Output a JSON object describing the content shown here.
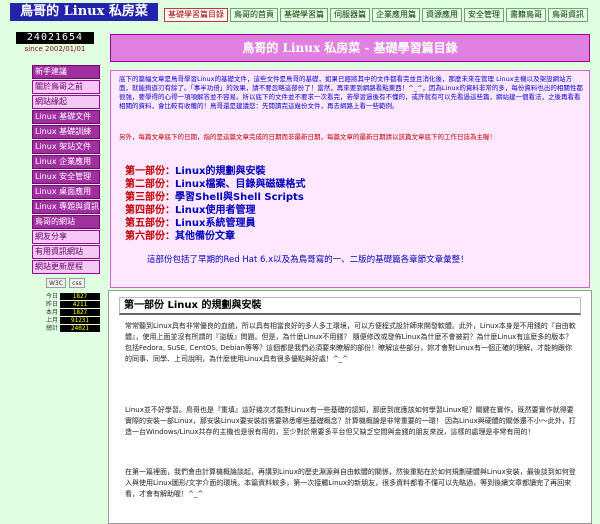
{
  "site": {
    "title": "鳥哥的 Linux 私房菜"
  },
  "nav": [
    {
      "label": "基礎學習篇目錄",
      "active": true
    },
    {
      "label": "鳥哥的首頁"
    },
    {
      "label": "基礎學習篇"
    },
    {
      "label": "伺服器篇"
    },
    {
      "label": "企業應用篇"
    },
    {
      "label": "資源應用"
    },
    {
      "label": "安全管理"
    },
    {
      "label": "書籍鳥哥"
    },
    {
      "label": "鳥哥資訊"
    }
  ],
  "counter": {
    "value": "24021654",
    "since": "since 2002/01/01"
  },
  "sidebar": [
    {
      "label": "新手建議",
      "dark": true
    },
    {
      "label": "關於鳥哥之前"
    },
    {
      "label": "網站緣起"
    },
    {
      "label": "Linux 基礎文件",
      "dark": true
    },
    {
      "label": "Linux 基礎訓練",
      "dark": true
    },
    {
      "label": "Linux 架站文件",
      "dark": true
    },
    {
      "label": "Linux 企業應用",
      "dark": true
    },
    {
      "label": "Linux 安全管理",
      "dark": true
    },
    {
      "label": "Linux 桌面應用",
      "dark": true
    },
    {
      "label": "Linux 專題與資訊",
      "dark": true
    },
    {
      "label": "鳥哥的網站",
      "dark": true
    },
    {
      "label": "網友分享"
    },
    {
      "label": "有用資訊網站"
    },
    {
      "label": "網站更新歷程"
    }
  ],
  "badges": [
    "W3C",
    "css"
  ],
  "clock": [
    {
      "label": "今日",
      "value": "1827"
    },
    {
      "label": "昨日",
      "value": "4211"
    },
    {
      "label": "本月",
      "value": "1827"
    },
    {
      "label": "上月",
      "value": "91231"
    },
    {
      "label": "總計",
      "value": "24021"
    }
  ],
  "banner": {
    "title": "鳥哥的 Linux 私房菜 - 基礎學習篇目錄"
  },
  "intro": {
    "p1": "底下的篇幅文章是鳥哥學習Linux的基礎文件，這些文件是鳥哥的基礎，如果已經將其中的文件都看完並且消化後，那麼未來在管理 Linux主機以及架設網站方面，就能夠遊刃有餘了。「事半功倍」的效果，請不要忽略這部份了！當然，再來要到網路看點東西！^_^，因為Linux的資料非常的多，每份資料也出的相關性都很強，要學得的心得一項項解答並不容易。所以底下的文件並不要求一次看完，若學習過後有不懂的，或許就有可以先看過這些篇，網站建一個看法，之後再看看相關的資料，會比較有收穫的！鳥哥還是建議您：先閱讀完這幾份文件，再去網路上看一些範例。",
    "p2": "另外，每篇文章底下的日期，指的是這篇文章完成的日期而非最新日期，每篇文章的最新日期請以該篇文章底下的工作日誌為主喔！",
    "toc": [
      {
        "label": "第一部份：",
        "text": "Linux的規劃與安裝"
      },
      {
        "label": "第二部份：",
        "text": "Linux檔案、目錄與磁碟格式"
      },
      {
        "label": "第三部份：",
        "text": "學習Shell與Shell Scripts"
      },
      {
        "label": "第四部份：",
        "text": "Linux使用者管理"
      },
      {
        "label": "第五部份：",
        "text": "Linux系統管理員"
      },
      {
        "label": "第六部份：",
        "text": "其他備份文章"
      }
    ],
    "note": "這部份包括了早期的Red Hat 6.x以及為鳥哥寫的一、二版的基礎篇各章節文章彙整！"
  },
  "section": {
    "title": "第一部份 Linux 的規劃與安裝",
    "p1": "常常聽到Linux具有非常優良的血統，所以具有相當良好的多人多工環境，可以方便程式設計師來開發軟體。此外，Linux本身是不用錢的『自由軟體』，使用上面並沒有所謂的『盜版』問題。但是，為什麼Linux不用錢？ 隨便修改或發佈Linux為什麼不會被罰？為什麼Linux有這麼多的版本？包括Fedora, SuSE, CentOS, Debian等等？這個都是我們必須要來瞭解的部份！瞭解這些部分，妳才會對Linux有一個正確的理解，才能夠跟你的同事、同學、上司說明，為什麼使用Linux具有很多優點與好處！^_^",
    "p2": "Linux並不好學習。鳥哥也是『重填』這好幾次才能對Linux有一些基礎的認知，那麼到底應該如何學習Linux呢？關鍵在實作。既然要實作就得要實際的安裝一部Linux，那安裝Linux要安裝前需要熟悉哪些基礎概念？計算機概論是非常重要的一環！ 因為Linux與硬體的關係還不小～此外，打造一台Windows/Linux共存的主機也是很有用的，至少對於需要多平台但又缺乏空間與金錢的朋友來說，這樣的處理是非常有用的！",
    "p3": "在第一篇裡面，我們會由計算機概論談起，再講到Linux的歷史淵源與自由軟體的關係，然後重點在於如何規劃硬體與Linux安裝，最後談到如何登入與使用Linux圖形/文字介面的環境。本篇資料較多，第一次接觸Linux的新朋友，很多資料都看不懂可以先略過，等到後續文章都讀完了再回來看，才會有解助喔！^_^"
  }
}
